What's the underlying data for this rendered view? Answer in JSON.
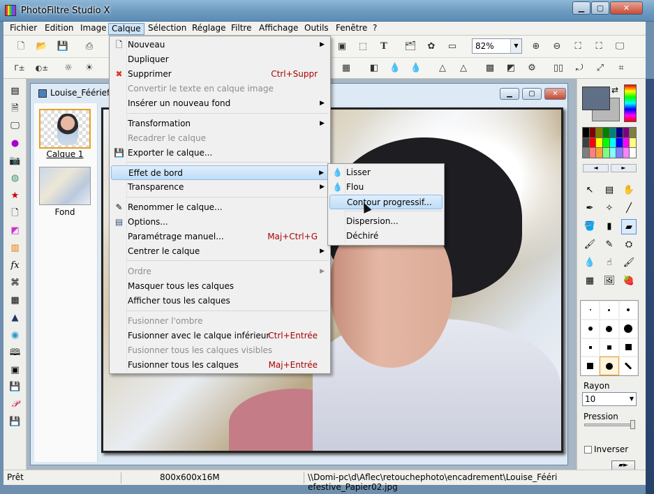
{
  "window": {
    "title": "PhotoFiltre Studio X"
  },
  "menubar": [
    "Fichier",
    "Edition",
    "Image",
    "Calque",
    "Sélection",
    "Réglage",
    "Filtre",
    "Affichage",
    "Outils",
    "Fenêtre",
    "?"
  ],
  "toolbar": {
    "zoom": "82%"
  },
  "document": {
    "title": "Louise_Fééri​efest"
  },
  "layers": {
    "layer1": "Calque 1",
    "background": "Fond"
  },
  "calque_menu": {
    "items": [
      {
        "label": "Nouveau",
        "submenu": true
      },
      {
        "label": "Dupliquer"
      },
      {
        "label": "Supprimer",
        "shortcut": "Ctrl+Suppr"
      },
      {
        "label": "Convertir le texte en calque image",
        "disabled": true
      },
      {
        "label": "Insérer un nouveau fond",
        "submenu": true
      },
      {
        "label": "Transformation",
        "submenu": true
      },
      {
        "label": "Recadrer le calque",
        "disabled": true
      },
      {
        "label": "Exporter le calque..."
      },
      {
        "label": "Effet de bord",
        "submenu": true,
        "highlighted": true
      },
      {
        "label": "Transparence",
        "submenu": true
      },
      {
        "label": "Renommer le calque..."
      },
      {
        "label": "Options..."
      },
      {
        "label": "Paramétrage manuel...",
        "shortcut": "Maj+Ctrl+G"
      },
      {
        "label": "Centrer le calque",
        "submenu": true
      },
      {
        "label": "Ordre",
        "submenu": true,
        "disabled": true
      },
      {
        "label": "Masquer tous les calques"
      },
      {
        "label": "Afficher tous les calques"
      },
      {
        "label": "Fusionner l'ombre",
        "disabled": true
      },
      {
        "label": "Fusionner avec le calque inférieur",
        "shortcut": "Ctrl+Entrée"
      },
      {
        "label": "Fusionner tous les calques visibles",
        "disabled": true
      },
      {
        "label": "Fusionner tous les calques",
        "shortcut": "Maj+Entrée"
      }
    ]
  },
  "effet_submenu": {
    "items": [
      {
        "label": "Lisser"
      },
      {
        "label": "Flou"
      },
      {
        "label": "Contour progressif...",
        "highlighted": true
      },
      {
        "label": "Dispersion..."
      },
      {
        "label": "Déchiré"
      }
    ]
  },
  "right_panel": {
    "rayon_label": "Rayon",
    "rayon_value": "10",
    "pression_label": "Pression",
    "pression_level": 0.95,
    "inverser_label": "Inverser"
  },
  "colors": {
    "foreground": "#5f6f86",
    "background": "#b8b8b8",
    "palette": [
      "#000000",
      "#7f0000",
      "#7f7f00",
      "#007f00",
      "#007f7f",
      "#00007f",
      "#7f007f",
      "#7f7f3f",
      "#3f3f3f",
      "#ff0000",
      "#ffff00",
      "#00ff00",
      "#00ffff",
      "#0000ff",
      "#ff00ff",
      "#ffff7f",
      "#7f7f7f",
      "#ff7f7f",
      "#ff9f3f",
      "#7fff7f",
      "#7fffff",
      "#7f7fff",
      "#ff7fff",
      "#ffffff"
    ]
  },
  "status": {
    "state": "Prêt",
    "size": "800x600x16M",
    "path": "\\\\Domi-pc\\d\\Aflec\\retouchephoto\\encadrement\\Louise_Fééri​efestive_Papier02.jpg"
  }
}
